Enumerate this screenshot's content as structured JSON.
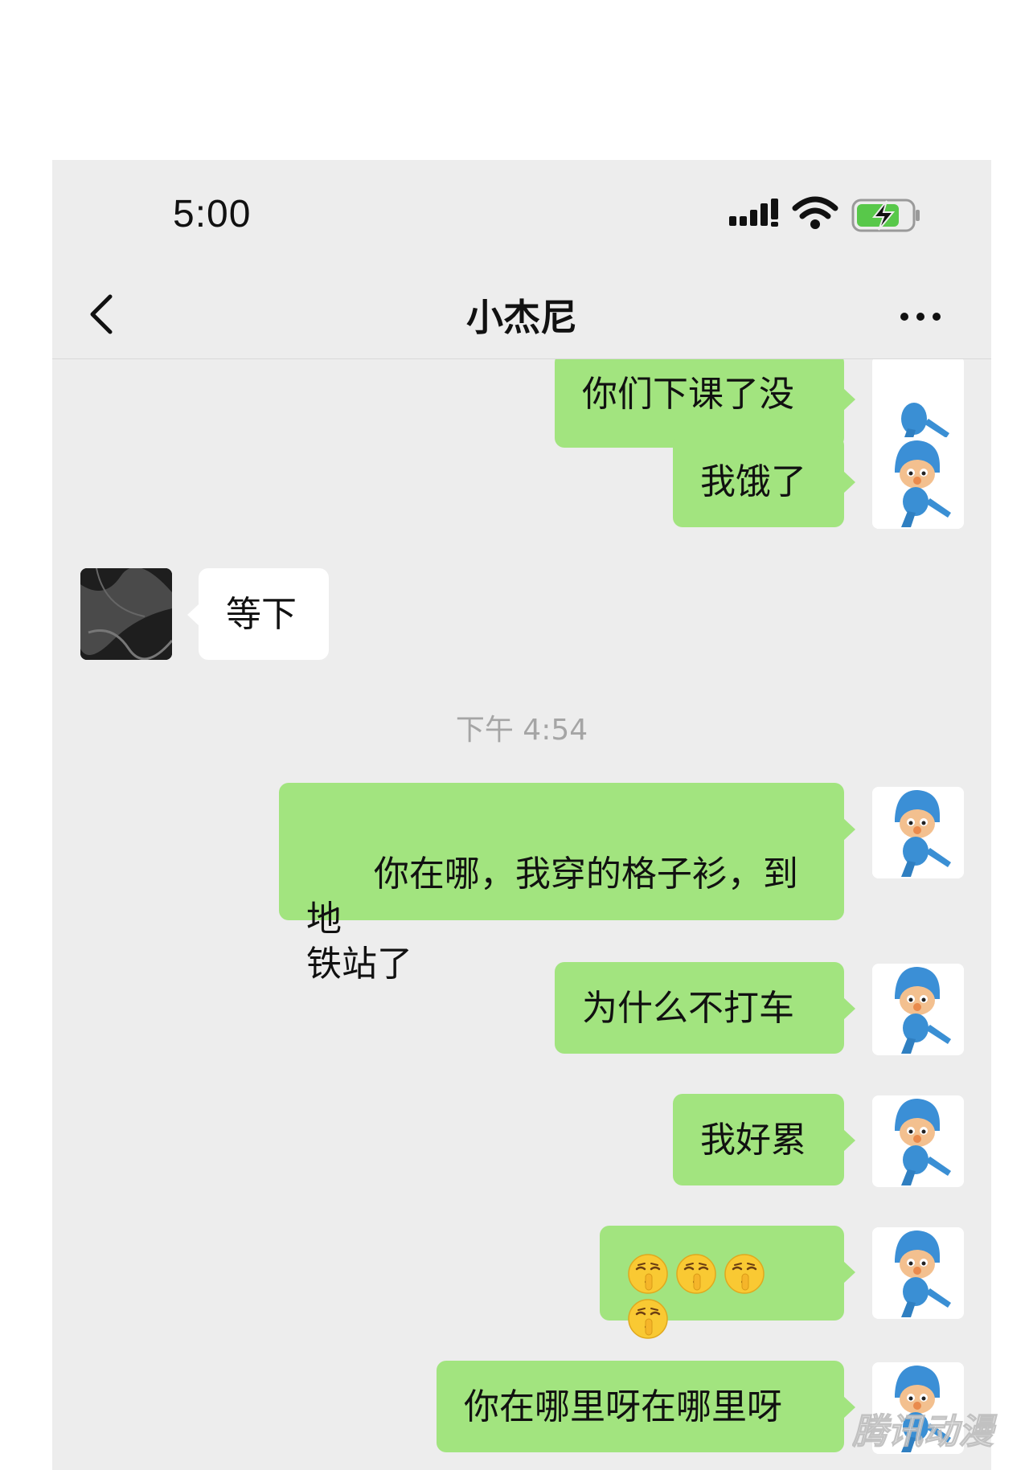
{
  "status_bar": {
    "time": "5:00"
  },
  "nav": {
    "title": "小杰尼"
  },
  "messages": [
    {
      "sender": "me",
      "text": "你们下课了没"
    },
    {
      "sender": "me",
      "text": "我饿了"
    },
    {
      "sender": "other",
      "text": "等下"
    },
    {
      "sender": "me",
      "text": "你在哪，我穿的格子衫，到地\n铁站了"
    },
    {
      "sender": "me",
      "text": "为什么不打车"
    },
    {
      "sender": "me",
      "text": "我好累"
    },
    {
      "sender": "me",
      "emoji": "shushing-face",
      "emoji_count": 4
    },
    {
      "sender": "me",
      "text": "你在哪里呀在哪里呀"
    }
  ],
  "timestamp": "下午 4:54",
  "watermark": "腾讯动漫",
  "colors": {
    "my_bubble": "#a2e47f",
    "their_bubble": "#ffffff",
    "background": "#ededed"
  }
}
